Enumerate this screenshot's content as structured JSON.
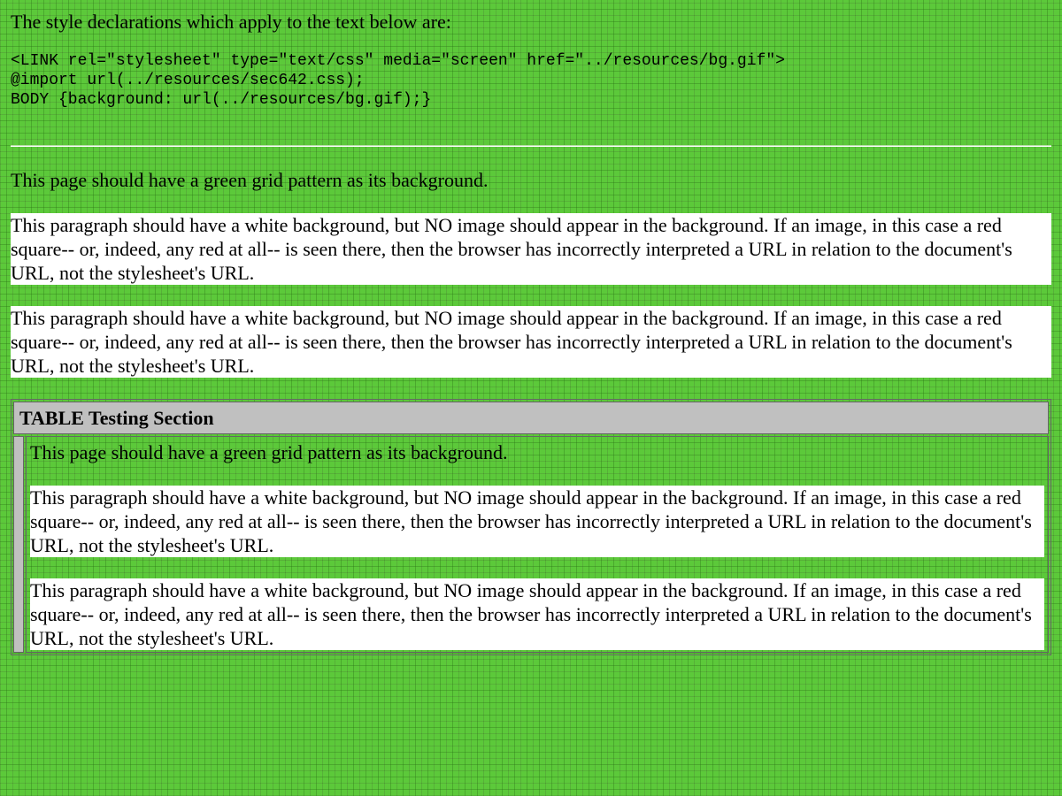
{
  "intro": "The style declarations which apply to the text below are:",
  "code_lines": [
    "<LINK rel=\"stylesheet\" type=\"text/css\" media=\"screen\" href=\"../resources/bg.gif\">",
    "@import url(../resources/sec642.css);",
    "BODY {background: url(../resources/bg.gif);}"
  ],
  "green_para": "This page should have a green grid pattern as its background.",
  "white_para": "This paragraph should have a white background, but NO image should appear in the background. If an image, in this case a red square-- or, indeed, any red at all-- is seen there, then the browser has incorrectly interpreted a URL in relation to the document's URL, not the stylesheet's URL.",
  "table": {
    "header": "TABLE Testing Section"
  },
  "colors": {
    "background": "#5cc93a",
    "white_para_bg": "#ffffff",
    "table_header_bg": "#c0c0c0"
  }
}
